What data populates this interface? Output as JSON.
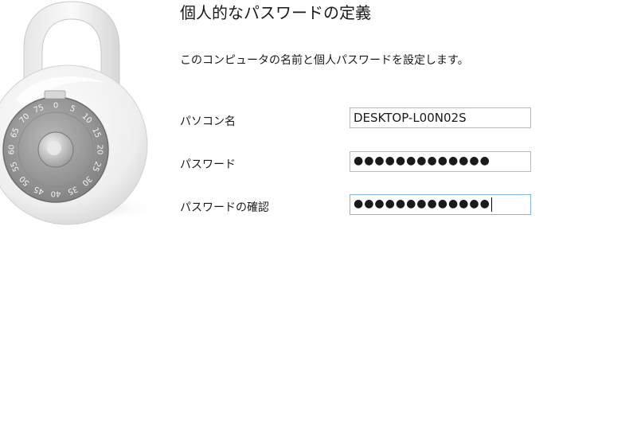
{
  "header": {
    "title": "個人的なパスワードの定義",
    "description": "このコンピュータの名前と個人パスワードを設定します。"
  },
  "form": {
    "pc_name": {
      "label": "パソコン名",
      "value": "DESKTOP-L00N02S"
    },
    "password": {
      "label": "パスワード",
      "masked_value": "●●●●●●●●●●●●●"
    },
    "password_confirm": {
      "label": "パスワードの確認",
      "masked_value": "●●●●●●●●●●●●●"
    }
  },
  "lock_image": {
    "icon": "padlock-combination-icon",
    "dial_numbers": [
      "0",
      "5",
      "10",
      "15",
      "20",
      "25",
      "30",
      "35",
      "40",
      "45",
      "50",
      "55",
      "60",
      "65",
      "70",
      "75"
    ]
  },
  "colors": {
    "text": "#1a1a1a",
    "field_border": "#b9b9b9",
    "focused_border": "#7eb4ea",
    "background": "#ffffff"
  }
}
